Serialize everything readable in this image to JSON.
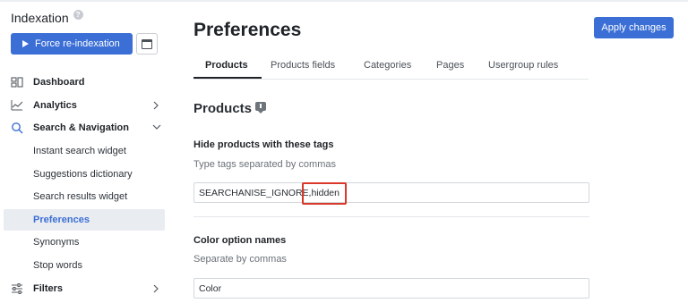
{
  "sidebar": {
    "indexation_title": "Indexation",
    "help_glyph": "?",
    "force_button": "Force re-indexation",
    "nav": [
      {
        "label": "Dashboard",
        "icon": "dashboard-icon"
      },
      {
        "label": "Analytics",
        "icon": "analytics-icon"
      },
      {
        "label": "Search & Navigation",
        "icon": "search-icon"
      }
    ],
    "subnav": [
      {
        "label": "Instant search widget"
      },
      {
        "label": "Suggestions dictionary"
      },
      {
        "label": "Search results widget"
      },
      {
        "label": "Preferences"
      },
      {
        "label": "Synonyms"
      },
      {
        "label": "Stop words"
      }
    ],
    "filters": {
      "label": "Filters",
      "icon": "filters-icon"
    }
  },
  "header": {
    "title": "Preferences",
    "apply_button": "Apply changes"
  },
  "tabs": [
    {
      "label": "Products"
    },
    {
      "label": "Products fields"
    },
    {
      "label": "Categories"
    },
    {
      "label": "Pages"
    },
    {
      "label": "Usergroup rules"
    }
  ],
  "section": {
    "title": "Products"
  },
  "fields": {
    "hide_tags": {
      "label": "Hide products with these tags",
      "hint": "Type tags separated by commas",
      "value_part1": "SEARCHANISE_IGNORE,",
      "value_part2": " hidden"
    },
    "color_option": {
      "label": "Color option names",
      "hint": "Separate by commas",
      "value": "Color"
    }
  },
  "colors": {
    "accent": "#3b6fd6",
    "highlight_box": "#d9382a",
    "active_bg": "#e9ecf0"
  }
}
